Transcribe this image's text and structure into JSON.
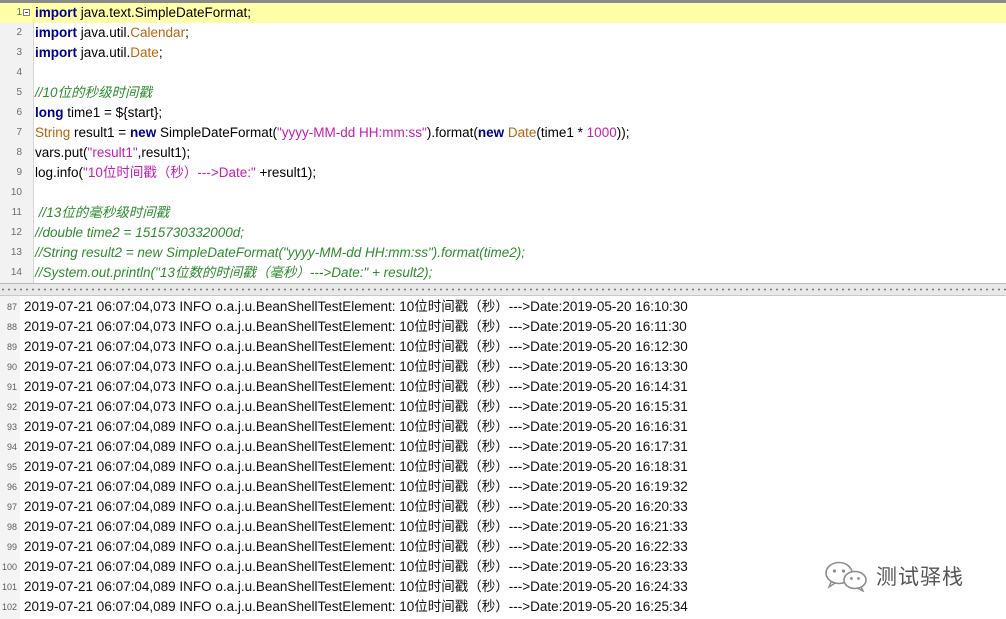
{
  "editor": {
    "lines": [
      {
        "n": "1",
        "segs": [
          {
            "t": "import",
            "c": "kw"
          },
          {
            "t": " java.text.SimpleDateFormat;",
            "c": "plain"
          }
        ]
      },
      {
        "n": "2",
        "segs": [
          {
            "t": "import",
            "c": "kw"
          },
          {
            "t": " java.util.",
            "c": "plain"
          },
          {
            "t": "Calendar",
            "c": "typ"
          },
          {
            "t": ";",
            "c": "plain"
          }
        ]
      },
      {
        "n": "3",
        "segs": [
          {
            "t": "import",
            "c": "kw"
          },
          {
            "t": " java.util.",
            "c": "plain"
          },
          {
            "t": "Date",
            "c": "typ"
          },
          {
            "t": ";",
            "c": "plain"
          }
        ]
      },
      {
        "n": "4",
        "segs": []
      },
      {
        "n": "5",
        "segs": [
          {
            "t": "//10位的秒级时间戳",
            "c": "cmt"
          }
        ]
      },
      {
        "n": "6",
        "segs": [
          {
            "t": "long",
            "c": "kw"
          },
          {
            "t": " time1 = ${start};",
            "c": "plain"
          }
        ]
      },
      {
        "n": "7",
        "segs": [
          {
            "t": "String",
            "c": "typ"
          },
          {
            "t": " result1 = ",
            "c": "plain"
          },
          {
            "t": "new",
            "c": "kw"
          },
          {
            "t": " SimpleDateFormat(",
            "c": "plain"
          },
          {
            "t": "\"yyyy-MM-dd HH:mm:ss\"",
            "c": "str"
          },
          {
            "t": ").format(",
            "c": "plain"
          },
          {
            "t": "new",
            "c": "kw"
          },
          {
            "t": " ",
            "c": "plain"
          },
          {
            "t": "Date",
            "c": "typ"
          },
          {
            "t": "(time1 * ",
            "c": "plain"
          },
          {
            "t": "1000",
            "c": "str"
          },
          {
            "t": "));",
            "c": "plain"
          }
        ]
      },
      {
        "n": "8",
        "segs": [
          {
            "t": "vars.put(",
            "c": "plain"
          },
          {
            "t": "\"result1\"",
            "c": "str"
          },
          {
            "t": ",result1);",
            "c": "plain"
          }
        ]
      },
      {
        "n": "9",
        "segs": [
          {
            "t": "log.info(",
            "c": "plain"
          },
          {
            "t": "\"10位时间戳（秒）--->Date:\"",
            "c": "str"
          },
          {
            "t": " +result1);",
            "c": "plain"
          }
        ]
      },
      {
        "n": "10",
        "segs": []
      },
      {
        "n": "11",
        "segs": [
          {
            "t": " //13位的毫秒级时间戳",
            "c": "cmt"
          }
        ]
      },
      {
        "n": "12",
        "segs": [
          {
            "t": "//double time2 = 1515730332000d;",
            "c": "cmt"
          }
        ]
      },
      {
        "n": "13",
        "segs": [
          {
            "t": "//String result2 = new SimpleDateFormat(\"yyyy-MM-dd HH:mm:ss\").format(time2);",
            "c": "cmt"
          }
        ]
      },
      {
        "n": "14",
        "segs": [
          {
            "t": "//System.out.println(\"13位数的时间戳（毫秒）--->Date:\" + result2);",
            "c": "cmt"
          }
        ]
      }
    ]
  },
  "log": {
    "lines": [
      {
        "n": "87",
        "text": "2019-07-21 06:07:04,073 INFO o.a.j.u.BeanShellTestElement: 10位时间戳（秒）--->Date:2019-05-20 16:10:30"
      },
      {
        "n": "88",
        "text": "2019-07-21 06:07:04,073 INFO o.a.j.u.BeanShellTestElement: 10位时间戳（秒）--->Date:2019-05-20 16:11:30"
      },
      {
        "n": "89",
        "text": "2019-07-21 06:07:04,073 INFO o.a.j.u.BeanShellTestElement: 10位时间戳（秒）--->Date:2019-05-20 16:12:30"
      },
      {
        "n": "90",
        "text": "2019-07-21 06:07:04,073 INFO o.a.j.u.BeanShellTestElement: 10位时间戳（秒）--->Date:2019-05-20 16:13:30"
      },
      {
        "n": "91",
        "text": "2019-07-21 06:07:04,073 INFO o.a.j.u.BeanShellTestElement: 10位时间戳（秒）--->Date:2019-05-20 16:14:31"
      },
      {
        "n": "92",
        "text": "2019-07-21 06:07:04,073 INFO o.a.j.u.BeanShellTestElement: 10位时间戳（秒）--->Date:2019-05-20 16:15:31"
      },
      {
        "n": "93",
        "text": "2019-07-21 06:07:04,089 INFO o.a.j.u.BeanShellTestElement: 10位时间戳（秒）--->Date:2019-05-20 16:16:31"
      },
      {
        "n": "94",
        "text": "2019-07-21 06:07:04,089 INFO o.a.j.u.BeanShellTestElement: 10位时间戳（秒）--->Date:2019-05-20 16:17:31"
      },
      {
        "n": "95",
        "text": "2019-07-21 06:07:04,089 INFO o.a.j.u.BeanShellTestElement: 10位时间戳（秒）--->Date:2019-05-20 16:18:31"
      },
      {
        "n": "96",
        "text": "2019-07-21 06:07:04,089 INFO o.a.j.u.BeanShellTestElement: 10位时间戳（秒）--->Date:2019-05-20 16:19:32"
      },
      {
        "n": "97",
        "text": "2019-07-21 06:07:04,089 INFO o.a.j.u.BeanShellTestElement: 10位时间戳（秒）--->Date:2019-05-20 16:20:33"
      },
      {
        "n": "98",
        "text": "2019-07-21 06:07:04,089 INFO o.a.j.u.BeanShellTestElement: 10位时间戳（秒）--->Date:2019-05-20 16:21:33"
      },
      {
        "n": "99",
        "text": "2019-07-21 06:07:04,089 INFO o.a.j.u.BeanShellTestElement: 10位时间戳（秒）--->Date:2019-05-20 16:22:33"
      },
      {
        "n": "100",
        "text": "2019-07-21 06:07:04,089 INFO o.a.j.u.BeanShellTestElement: 10位时间戳（秒）--->Date:2019-05-20 16:23:33"
      },
      {
        "n": "101",
        "text": "2019-07-21 06:07:04,089 INFO o.a.j.u.BeanShellTestElement: 10位时间戳（秒）--->Date:2019-05-20 16:24:33"
      },
      {
        "n": "102",
        "text": "2019-07-21 06:07:04,089 INFO o.a.j.u.BeanShellTestElement: 10位时间戳（秒）--->Date:2019-05-20 16:25:34"
      }
    ]
  },
  "watermark": {
    "icon": "wechat-official-account-icon",
    "text": "测试驿栈"
  },
  "colors": {
    "current_line": "#ffffa8",
    "keyword": "#00008b",
    "type": "#b7660c",
    "string": "#c41eb4",
    "comment": "#2e8b2e"
  }
}
